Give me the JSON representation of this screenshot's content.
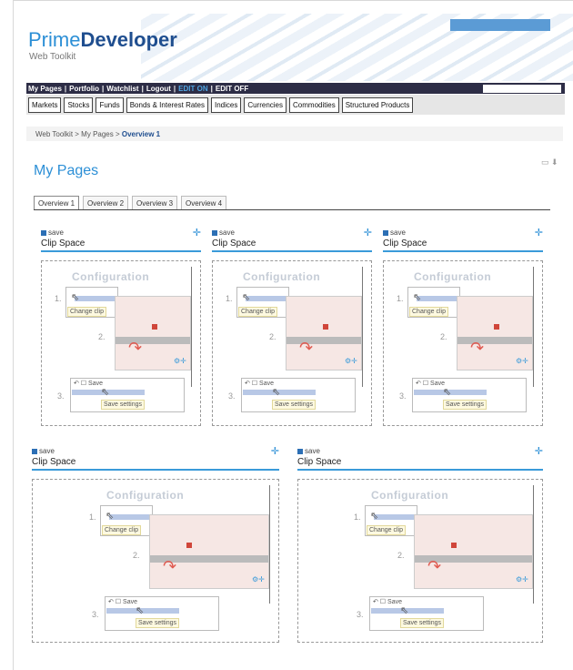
{
  "header": {
    "logo_prime": "Prime",
    "logo_developer": "Developer",
    "tagline": "Web Toolkit"
  },
  "topnav": {
    "links": [
      "My Pages",
      "Portfolio",
      "Watchlist",
      "Logout"
    ],
    "edit_on": "EDIT ON",
    "edit_off": "EDIT OFF",
    "separator": "|"
  },
  "markets": [
    "Markets",
    "Stocks",
    "Funds",
    "Bonds & Interest Rates",
    "Indices",
    "Currencies",
    "Commodities",
    "Structured Products"
  ],
  "breadcrumb": {
    "path": "Web Toolkit > My Pages > ",
    "current": "Overview 1"
  },
  "page_title": "My Pages",
  "overview_tabs": [
    "Overview 1",
    "Overview 2",
    "Overview 3",
    "Overview 4"
  ],
  "portlet": {
    "save_label": "save",
    "title": "Clip Space",
    "config_title": "Configuration",
    "change_clip": "Change clip",
    "save_settings": "Save settings",
    "save_small": "Save",
    "step1": "1.",
    "step2": "2.",
    "step3": "3."
  },
  "colors": {
    "accent": "#2c8fd6",
    "nav_bg": "#2d2d46",
    "edit_on": "#4fa3e0"
  }
}
